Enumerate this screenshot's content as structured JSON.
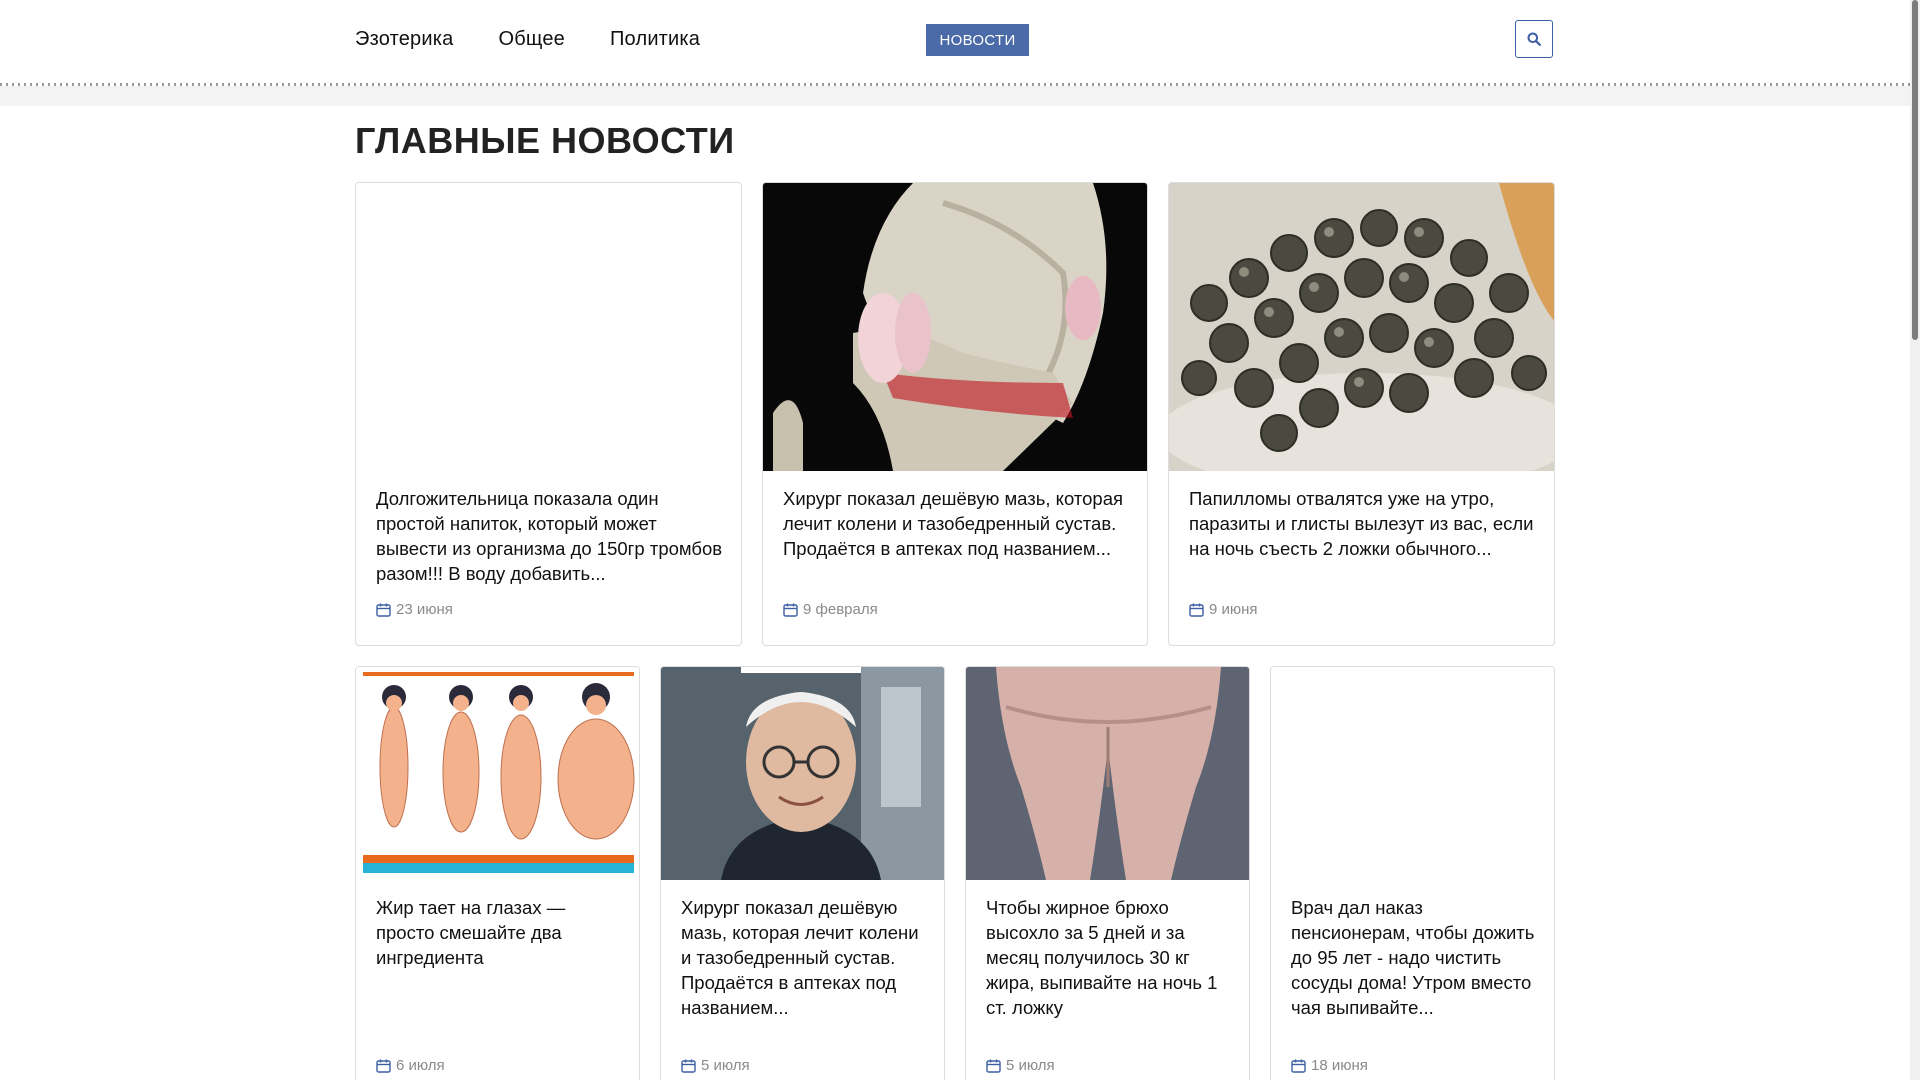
{
  "nav": {
    "items": [
      "Эзотерика",
      "Общее",
      "Политика"
    ],
    "news_button": "НОВОСТИ"
  },
  "section_title": "ГЛАВНЫЕ НОВОСТИ",
  "cards_row1": [
    {
      "title": "Долгожительница показала один простой напиток, который может вывести из организма до 150гр тромбов разом!!! В воду добавить...",
      "date": "23 июня"
    },
    {
      "title": "Хирург показал дешёвую мазь, которая лечит колени и тазобедренный сустав. Продаётся в аптеках под названием...",
      "date": "9 февраля"
    },
    {
      "title": "Папилломы отвалятся уже на утро, паразиты и глисты вылезут из вас, если на ночь съесть 2 ложки обычного...",
      "date": "9 июня"
    }
  ],
  "cards_row2": [
    {
      "title": "Жир тает на глазах — просто смешайте два ингредиента",
      "date": "6 июля"
    },
    {
      "title": "Хирург показал дешёвую мазь, которая лечит колени и тазобедренный сустав. Продаётся в аптеках под названием...",
      "date": "5 июля"
    },
    {
      "title": "Чтобы жирное брюхо высохло за 5 дней и за месяц получилось 30 кг жира, выпивайте на ночь 1 ст. ложку",
      "date": "5 июля"
    },
    {
      "title": "Врач дал наказ пенсионерам, чтобы дожить до 95 лет - надо чистить сосуды дома! Утром вместо чая выпивайте...",
      "date": "18 июня"
    }
  ],
  "colors": {
    "accent": "#4a6aa8",
    "date_icon": "#3d5fa3"
  },
  "icons": {
    "search": "search-icon",
    "calendar": "calendar-icon"
  }
}
